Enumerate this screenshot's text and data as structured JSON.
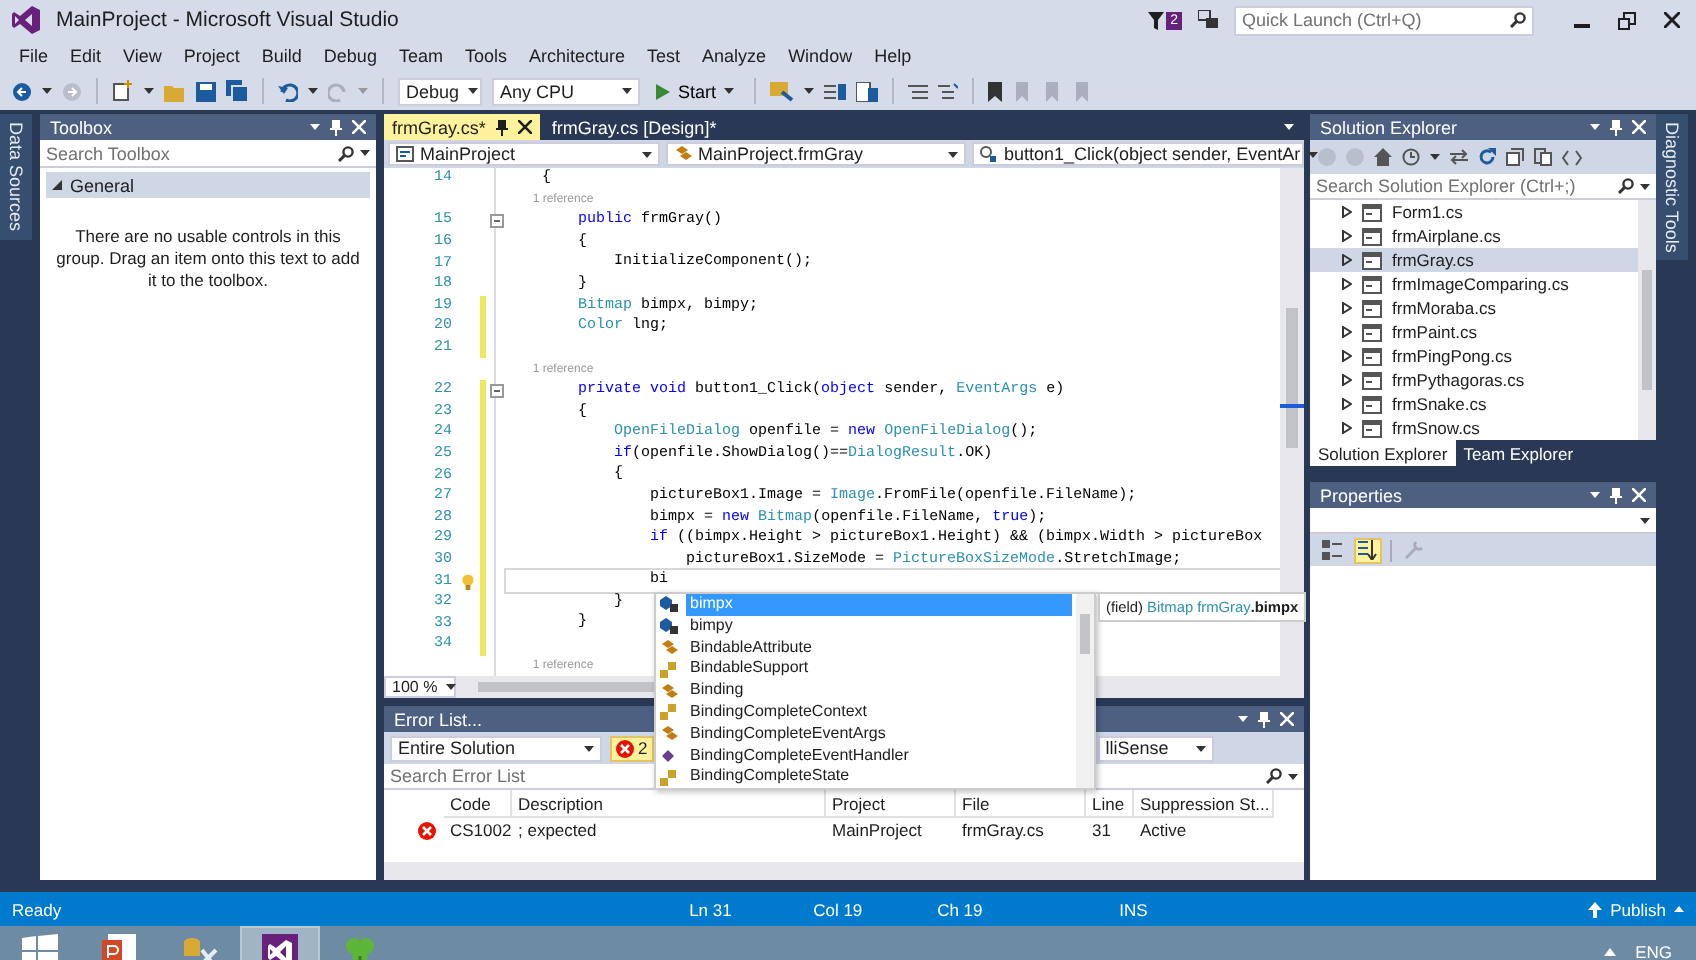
{
  "window": {
    "title": "MainProject - Microsoft Visual Studio",
    "notification_count": "2",
    "quick_launch": {
      "placeholder": "Quick Launch (Ctrl+Q)"
    }
  },
  "menu": [
    "File",
    "Edit",
    "View",
    "Project",
    "Build",
    "Debug",
    "Team",
    "Tools",
    "Architecture",
    "Test",
    "Analyze",
    "Window",
    "Help"
  ],
  "toolbar": {
    "configuration": "Debug",
    "platform": "Any CPU",
    "start": "Start"
  },
  "left_strip": {
    "label": "Data Sources"
  },
  "toolbox": {
    "title": "Toolbox",
    "search": {
      "placeholder": "Search Toolbox"
    },
    "group": {
      "label": "General",
      "expanded": true
    },
    "message": "There are no usable controls in this group. Drag an item onto this text to add it to the toolbox."
  },
  "editor": {
    "tabs": [
      {
        "label": "frmGray.cs*",
        "selected": true
      },
      {
        "label": "frmGray.cs [Design]*",
        "selected": false
      }
    ],
    "nav": [
      {
        "kind": "project",
        "label": "MainProject"
      },
      {
        "kind": "type",
        "label": "MainProject.frmGray"
      },
      {
        "kind": "member",
        "label": "button1_Click(object sender, EventAr"
      }
    ],
    "lines": [
      {
        "kind": "code",
        "number": "14",
        "folds": false,
        "modified": false,
        "current": false,
        "tokens": [
          {
            "kind": "text",
            "text": "    {"
          }
        ]
      },
      {
        "kind": "lens",
        "text": "1 reference"
      },
      {
        "kind": "code",
        "number": "15",
        "folds": true,
        "modified": false,
        "current": false,
        "tokens": [
          {
            "kind": "kw",
            "text": "        public"
          },
          {
            "kind": "text",
            "text": " frmGray()"
          }
        ]
      },
      {
        "kind": "code",
        "number": "16",
        "folds": false,
        "modified": false,
        "current": false,
        "tokens": [
          {
            "kind": "text",
            "text": "        {"
          }
        ]
      },
      {
        "kind": "code",
        "number": "17",
        "folds": false,
        "modified": false,
        "current": false,
        "tokens": [
          {
            "kind": "text",
            "text": "            InitializeComponent();"
          }
        ]
      },
      {
        "kind": "code",
        "number": "18",
        "folds": false,
        "modified": false,
        "current": false,
        "tokens": [
          {
            "kind": "text",
            "text": "        }"
          }
        ]
      },
      {
        "kind": "code",
        "number": "19",
        "folds": false,
        "modified": true,
        "current": false,
        "tokens": [
          {
            "kind": "type",
            "text": "        Bitmap"
          },
          {
            "kind": "text",
            "text": " bimpx, bimpy;"
          }
        ]
      },
      {
        "kind": "code",
        "number": "20",
        "folds": false,
        "modified": true,
        "current": false,
        "tokens": [
          {
            "kind": "type",
            "text": "        Color"
          },
          {
            "kind": "text",
            "text": " lng;"
          }
        ]
      },
      {
        "kind": "code",
        "number": "21",
        "folds": false,
        "modified": true,
        "current": false
      },
      {
        "kind": "lens",
        "text": "1 reference"
      },
      {
        "kind": "code",
        "number": "22",
        "folds": true,
        "modified": true,
        "current": false,
        "tokens": [
          {
            "kind": "kw",
            "text": "        private"
          },
          {
            "kind": "kw",
            "text": " void"
          },
          {
            "kind": "text",
            "text": " button1_Click("
          },
          {
            "kind": "kw",
            "text": "object"
          },
          {
            "kind": "text",
            "text": " sender, "
          },
          {
            "kind": "type",
            "text": "EventArgs"
          },
          {
            "kind": "text",
            "text": " e)"
          }
        ]
      },
      {
        "kind": "code",
        "number": "23",
        "folds": false,
        "modified": true,
        "current": false,
        "tokens": [
          {
            "kind": "text",
            "text": "        {"
          }
        ]
      },
      {
        "kind": "code",
        "number": "24",
        "folds": false,
        "modified": true,
        "current": false,
        "tokens": [
          {
            "kind": "type",
            "text": "            OpenFileDialog"
          },
          {
            "kind": "text",
            "text": " openfile = "
          },
          {
            "kind": "kw",
            "text": "new"
          },
          {
            "kind": "type",
            "text": " OpenFileDialog"
          },
          {
            "kind": "text",
            "text": "();"
          }
        ]
      },
      {
        "kind": "code",
        "number": "25",
        "folds": false,
        "modified": true,
        "current": false,
        "tokens": [
          {
            "kind": "kw",
            "text": "            if"
          },
          {
            "kind": "text",
            "text": "(openfile.ShowDialog()=="
          },
          {
            "kind": "type",
            "text": "DialogResult"
          },
          {
            "kind": "text",
            "text": ".OK)"
          }
        ]
      },
      {
        "kind": "code",
        "number": "26",
        "folds": false,
        "modified": true,
        "current": false,
        "tokens": [
          {
            "kind": "text",
            "text": "            {"
          }
        ]
      },
      {
        "kind": "code",
        "number": "27",
        "folds": false,
        "modified": true,
        "current": false,
        "tokens": [
          {
            "kind": "text",
            "text": "                pictureBox1.Image = "
          },
          {
            "kind": "type",
            "text": "Image"
          },
          {
            "kind": "text",
            "text": ".FromFile(openfile.FileName);"
          }
        ]
      },
      {
        "kind": "code",
        "number": "28",
        "folds": false,
        "modified": true,
        "current": false,
        "tokens": [
          {
            "kind": "text",
            "text": "                bimpx = "
          },
          {
            "kind": "kw",
            "text": "new"
          },
          {
            "kind": "type",
            "text": " Bitmap"
          },
          {
            "kind": "text",
            "text": "(openfile.FileName, "
          },
          {
            "kind": "kw",
            "text": "true"
          },
          {
            "kind": "text",
            "text": ");"
          }
        ]
      },
      {
        "kind": "code",
        "number": "29",
        "folds": false,
        "modified": true,
        "current": false,
        "tokens": [
          {
            "kind": "kw",
            "text": "                if"
          },
          {
            "kind": "text",
            "text": " ((bimpx.Height > pictureBox1.Height) && (bimpx.Width > pictureBox"
          }
        ]
      },
      {
        "kind": "code",
        "number": "30",
        "folds": false,
        "modified": true,
        "current": false,
        "tokens": [
          {
            "kind": "text",
            "text": "                    pictureBox1.SizeMode = "
          },
          {
            "kind": "type",
            "text": "PictureBoxSizeMode"
          },
          {
            "kind": "text",
            "text": ".StretchImage;"
          }
        ]
      },
      {
        "kind": "code",
        "number": "31",
        "folds": false,
        "modified": true,
        "current": true,
        "tokens": [
          {
            "kind": "text",
            "text": "                bi"
          }
        ]
      },
      {
        "kind": "code",
        "number": "32",
        "folds": false,
        "modified": true,
        "current": false,
        "tokens": [
          {
            "kind": "text",
            "text": "            }"
          }
        ]
      },
      {
        "kind": "code",
        "number": "33",
        "folds": false,
        "modified": true,
        "current": false,
        "tokens": [
          {
            "kind": "text",
            "text": "        }"
          }
        ]
      },
      {
        "kind": "code",
        "number": "34",
        "folds": false,
        "modified": true,
        "current": false
      },
      {
        "kind": "lens",
        "text": "1 reference"
      }
    ],
    "zoom": "100 %"
  },
  "completion": {
    "items": [
      {
        "kind": "field",
        "label": "bimpx",
        "selected": true
      },
      {
        "kind": "field",
        "label": "bimpy",
        "selected": false
      },
      {
        "kind": "class",
        "label": "BindableAttribute",
        "selected": false
      },
      {
        "kind": "enum",
        "label": "BindableSupport",
        "selected": false
      },
      {
        "kind": "class",
        "label": "Binding",
        "selected": false
      },
      {
        "kind": "enum",
        "label": "BindingCompleteContext",
        "selected": false
      },
      {
        "kind": "class",
        "label": "BindingCompleteEventArgs",
        "selected": false
      },
      {
        "kind": "delegate",
        "label": "BindingCompleteEventHandler",
        "selected": false
      },
      {
        "kind": "enum",
        "label": "BindingCompleteState",
        "selected": false
      }
    ],
    "tooltip": [
      {
        "kind": "text",
        "text": "(field) "
      },
      {
        "kind": "type",
        "text": "Bitmap"
      },
      {
        "kind": "type",
        "text": " frmGray"
      },
      {
        "kind": "bold",
        "text": ".bimpx"
      }
    ]
  },
  "error_list": {
    "title": "Error List...",
    "scope": "Entire Solution",
    "errors_badge": "2",
    "source": "lliSense",
    "search": {
      "placeholder": "Search Error List"
    },
    "columns": [
      "Code",
      "Description",
      "Project",
      "File",
      "Line",
      "Suppression St..."
    ],
    "rows": [
      {
        "kind": "error",
        "cells": [
          "CS1002",
          "; expected",
          "MainProject",
          "frmGray.cs",
          "31",
          "Active"
        ]
      }
    ]
  },
  "solution_explorer": {
    "title": "Solution Explorer",
    "search": {
      "placeholder": "Search Solution Explorer (Ctrl+;)"
    },
    "items": [
      {
        "label": "Form1.cs",
        "expanded": false,
        "selected": false
      },
      {
        "label": "frmAirplane.cs",
        "expanded": false,
        "selected": false
      },
      {
        "label": "frmGray.cs",
        "expanded": false,
        "selected": true
      },
      {
        "label": "frmImageComparing.cs",
        "expanded": false,
        "selected": false
      },
      {
        "label": "frmMoraba.cs",
        "expanded": false,
        "selected": false
      },
      {
        "label": "frmPaint.cs",
        "expanded": false,
        "selected": false
      },
      {
        "label": "frmPingPong.cs",
        "expanded": false,
        "selected": false
      },
      {
        "label": "frmPythagoras.cs",
        "expanded": false,
        "selected": false
      },
      {
        "label": "frmSnake.cs",
        "expanded": false,
        "selected": false
      },
      {
        "label": "frmSnow.cs",
        "expanded": false,
        "selected": false
      }
    ],
    "tabs": [
      {
        "label": "Solution Explorer",
        "selected": true
      },
      {
        "label": "Team Explorer",
        "selected": false
      }
    ]
  },
  "properties": {
    "title": "Properties",
    "view_buttons": [
      {
        "kind": "categorized",
        "selected": false
      },
      {
        "kind": "alphabetical",
        "selected": true
      },
      {
        "kind": "property-pages",
        "selected": false
      }
    ]
  },
  "right_strip": {
    "label": "Diagnostic Tools"
  },
  "status_bar": {
    "state": "Ready",
    "line": "Ln 31",
    "column": "Col 19",
    "character": "Ch 19",
    "mode": "INS",
    "publish": "Publish"
  },
  "taskbar": {
    "apps": [
      {
        "kind": "windows",
        "selected": false
      },
      {
        "kind": "slides",
        "selected": false
      },
      {
        "kind": "tools",
        "selected": false
      },
      {
        "kind": "ide",
        "selected": true
      },
      {
        "kind": "clover",
        "selected": false
      }
    ],
    "language": "ENG"
  }
}
